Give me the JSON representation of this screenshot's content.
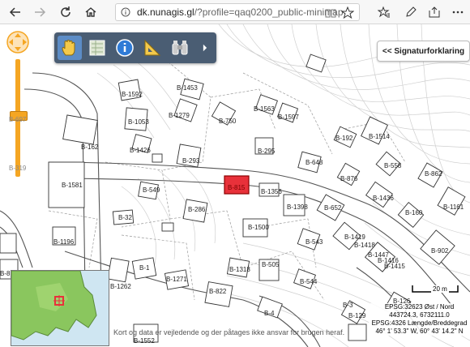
{
  "browser": {
    "url_host": "dk.nunagis.gl",
    "url_path": "/?profile=qaq0200_public-minimap"
  },
  "toolbar": {
    "tools": [
      {
        "name": "pan",
        "icon": "hand-icon"
      },
      {
        "name": "layers",
        "icon": "map-layers-icon"
      },
      {
        "name": "info",
        "icon": "info-icon"
      },
      {
        "name": "measure",
        "icon": "ruler-triangle-icon"
      },
      {
        "name": "binoculars",
        "icon": "binoculars-icon"
      },
      {
        "name": "more",
        "icon": "chevron-right-icon"
      }
    ]
  },
  "zoom": {
    "level_labels": [
      "B-697",
      "B-319"
    ]
  },
  "legend": {
    "label": "<< Signaturforklaring"
  },
  "map": {
    "building_labels": [
      "B-1453",
      "B-1592",
      "B-1279",
      "B-1053",
      "B-750",
      "B-1563",
      "B-1597",
      "B-162",
      "B-1426",
      "B-1514",
      "B-192",
      "B-295",
      "B-293",
      "B-648",
      "B-558",
      "B-1581",
      "B-876",
      "B-862",
      "B-549",
      "B-815",
      "B-1356",
      "B-1436",
      "B-286",
      "B-652",
      "B-1398",
      "B-1161",
      "B-160",
      "B-32",
      "B-1500",
      "B-1419",
      "B-543",
      "B-1418",
      "B-1196",
      "B-902",
      "B-1447",
      "B-1416",
      "B-1415",
      "B-1",
      "B-1318",
      "B-505",
      "B-1262",
      "B-1271",
      "B-544",
      "B-822",
      "B-4",
      "B-126",
      "B-3",
      "B-1552",
      "B-129",
      "B-8"
    ],
    "selected_building": "B-815",
    "highlight_color": "#e8313a"
  },
  "scale": {
    "label": "20 m"
  },
  "coordinates": {
    "line1": "EPSG:32623 Øst / Nord",
    "line2": "443724.3, 6732111.0",
    "line3": "EPSG:4326 Længde/Breddegrad",
    "line4": "46° 1' 53.3\" W, 60° 43' 14.2\" N"
  },
  "disclaimer": "Kort og data er vejledende og der påtages ikke ansvar for brugen heraf."
}
